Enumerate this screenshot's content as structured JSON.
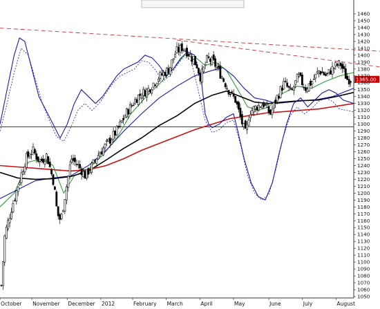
{
  "chart_data": {
    "type": "candlestick",
    "x_labels": [
      "October",
      "November",
      "December",
      "2012",
      "February",
      "March",
      "April",
      "May",
      "June",
      "July",
      "August"
    ],
    "y_ticks": [
      1050,
      1060,
      1070,
      1080,
      1090,
      1100,
      1110,
      1120,
      1130,
      1140,
      1150,
      1160,
      1170,
      1180,
      1190,
      1200,
      1210,
      1220,
      1230,
      1240,
      1250,
      1260,
      1270,
      1280,
      1290,
      1300,
      1310,
      1320,
      1330,
      1340,
      1350,
      1360,
      1370,
      1380,
      1390,
      1400,
      1410,
      1420,
      1430,
      1440,
      1450,
      1460
    ],
    "ylim": [
      1048,
      1468
    ],
    "last_price": {
      "label": "1365.00",
      "value": 1365
    },
    "horizontal_line": 1296,
    "trend_lines": [
      {
        "from": {
          "t": -0.02,
          "v": 1440
        },
        "to": {
          "t": 1.0,
          "v": 1408
        }
      },
      {
        "from": {
          "t": 0.5,
          "v": 1422
        },
        "to": {
          "t": 1.0,
          "v": 1388
        }
      }
    ],
    "close_anchors": [
      [
        0.0,
        1066
      ],
      [
        0.01,
        1140
      ],
      [
        0.03,
        1180
      ],
      [
        0.05,
        1215
      ],
      [
        0.07,
        1250
      ],
      [
        0.09,
        1262
      ],
      [
        0.11,
        1245
      ],
      [
        0.13,
        1255
      ],
      [
        0.15,
        1215
      ],
      [
        0.16,
        1170
      ],
      [
        0.17,
        1160
      ],
      [
        0.18,
        1190
      ],
      [
        0.2,
        1250
      ],
      [
        0.22,
        1240
      ],
      [
        0.24,
        1225
      ],
      [
        0.26,
        1240
      ],
      [
        0.28,
        1258
      ],
      [
        0.3,
        1270
      ],
      [
        0.33,
        1290
      ],
      [
        0.36,
        1318
      ],
      [
        0.39,
        1340
      ],
      [
        0.42,
        1350
      ],
      [
        0.45,
        1368
      ],
      [
        0.48,
        1380
      ],
      [
        0.5,
        1405
      ],
      [
        0.52,
        1412
      ],
      [
        0.54,
        1400
      ],
      [
        0.56,
        1385
      ],
      [
        0.57,
        1368
      ],
      [
        0.59,
        1395
      ],
      [
        0.61,
        1388
      ],
      [
        0.63,
        1370
      ],
      [
        0.65,
        1350
      ],
      [
        0.67,
        1335
      ],
      [
        0.69,
        1300
      ],
      [
        0.7,
        1285
      ],
      [
        0.71,
        1318
      ],
      [
        0.73,
        1325
      ],
      [
        0.75,
        1330
      ],
      [
        0.77,
        1315
      ],
      [
        0.79,
        1340
      ],
      [
        0.81,
        1360
      ],
      [
        0.83,
        1345
      ],
      [
        0.85,
        1370
      ],
      [
        0.87,
        1352
      ],
      [
        0.89,
        1362
      ],
      [
        0.91,
        1378
      ],
      [
        0.93,
        1370
      ],
      [
        0.95,
        1382
      ],
      [
        0.97,
        1388
      ],
      [
        0.99,
        1365
      ],
      [
        1.0,
        1365
      ]
    ],
    "series": [
      {
        "color": "#2ea02e",
        "values": [
          [
            0.0,
            1180
          ],
          [
            0.04,
            1200
          ],
          [
            0.08,
            1245
          ],
          [
            0.12,
            1250
          ],
          [
            0.15,
            1240
          ],
          [
            0.18,
            1200
          ],
          [
            0.21,
            1225
          ],
          [
            0.25,
            1235
          ],
          [
            0.29,
            1255
          ],
          [
            0.33,
            1280
          ],
          [
            0.37,
            1315
          ],
          [
            0.41,
            1338
          ],
          [
            0.45,
            1358
          ],
          [
            0.49,
            1380
          ],
          [
            0.52,
            1400
          ],
          [
            0.55,
            1398
          ],
          [
            0.58,
            1385
          ],
          [
            0.61,
            1390
          ],
          [
            0.64,
            1378
          ],
          [
            0.67,
            1352
          ],
          [
            0.7,
            1325
          ],
          [
            0.73,
            1320
          ],
          [
            0.76,
            1325
          ],
          [
            0.8,
            1345
          ],
          [
            0.84,
            1355
          ],
          [
            0.88,
            1352
          ],
          [
            0.92,
            1362
          ],
          [
            0.96,
            1370
          ],
          [
            1.0,
            1375
          ]
        ]
      },
      {
        "color": "#1a1aaa",
        "values": [
          [
            0.0,
            1192
          ],
          [
            0.05,
            1205
          ],
          [
            0.1,
            1218
          ],
          [
            0.15,
            1222
          ],
          [
            0.2,
            1225
          ],
          [
            0.25,
            1240
          ],
          [
            0.3,
            1262
          ],
          [
            0.35,
            1290
          ],
          [
            0.4,
            1315
          ],
          [
            0.45,
            1338
          ],
          [
            0.5,
            1355
          ],
          [
            0.55,
            1370
          ],
          [
            0.6,
            1378
          ],
          [
            0.63,
            1382
          ],
          [
            0.66,
            1370
          ],
          [
            0.69,
            1352
          ],
          [
            0.72,
            1338
          ],
          [
            0.75,
            1335
          ],
          [
            0.78,
            1330
          ],
          [
            0.82,
            1332
          ],
          [
            0.86,
            1334
          ],
          [
            0.9,
            1336
          ],
          [
            0.94,
            1340
          ],
          [
            1.0,
            1352
          ]
        ]
      },
      {
        "color": "#000000",
        "values": [
          [
            0.0,
            1230
          ],
          [
            0.05,
            1222
          ],
          [
            0.1,
            1220
          ],
          [
            0.15,
            1221
          ],
          [
            0.2,
            1224
          ],
          [
            0.25,
            1232
          ],
          [
            0.3,
            1248
          ],
          [
            0.35,
            1265
          ],
          [
            0.4,
            1280
          ],
          [
            0.45,
            1298
          ],
          [
            0.5,
            1312
          ],
          [
            0.55,
            1330
          ],
          [
            0.6,
            1342
          ],
          [
            0.64,
            1348
          ],
          [
            0.68,
            1340
          ],
          [
            0.72,
            1332
          ],
          [
            0.76,
            1330
          ],
          [
            0.8,
            1332
          ],
          [
            0.85,
            1334
          ],
          [
            0.9,
            1335
          ],
          [
            0.95,
            1340
          ],
          [
            1.0,
            1346
          ]
        ]
      },
      {
        "color": "#cc1111",
        "values": [
          [
            0.0,
            1240
          ],
          [
            0.05,
            1238
          ],
          [
            0.1,
            1236
          ],
          [
            0.15,
            1234
          ],
          [
            0.2,
            1232
          ],
          [
            0.25,
            1234
          ],
          [
            0.3,
            1240
          ],
          [
            0.35,
            1250
          ],
          [
            0.4,
            1262
          ],
          [
            0.45,
            1272
          ],
          [
            0.5,
            1282
          ],
          [
            0.55,
            1292
          ],
          [
            0.6,
            1300
          ],
          [
            0.65,
            1308
          ],
          [
            0.7,
            1312
          ],
          [
            0.75,
            1316
          ],
          [
            0.8,
            1318
          ],
          [
            0.85,
            1320
          ],
          [
            0.9,
            1322
          ],
          [
            0.95,
            1326
          ],
          [
            1.0,
            1330
          ]
        ]
      },
      {
        "color": "#1a1aaa",
        "values": [
          [
            0.0,
            1300
          ],
          [
            0.02,
            1350
          ],
          [
            0.04,
            1400
          ],
          [
            0.055,
            1425
          ],
          [
            0.07,
            1420
          ],
          [
            0.09,
            1380
          ],
          [
            0.11,
            1340
          ],
          [
            0.13,
            1320
          ],
          [
            0.15,
            1300
          ],
          [
            0.17,
            1280
          ],
          [
            0.19,
            1300
          ],
          [
            0.21,
            1330
          ],
          [
            0.23,
            1350
          ],
          [
            0.25,
            1340
          ],
          [
            0.27,
            1330
          ],
          [
            0.29,
            1340
          ],
          [
            0.31,
            1355
          ],
          [
            0.33,
            1370
          ],
          [
            0.35,
            1380
          ],
          [
            0.37,
            1385
          ],
          [
            0.39,
            1390
          ],
          [
            0.41,
            1400
          ],
          [
            0.43,
            1396
          ],
          [
            0.45,
            1385
          ],
          [
            0.47,
            1370
          ],
          [
            0.49,
            1380
          ],
          [
            0.51,
            1395
          ],
          [
            0.53,
            1405
          ],
          [
            0.55,
            1400
          ],
          [
            0.57,
            1360
          ],
          [
            0.58,
            1315
          ],
          [
            0.59,
            1300
          ],
          [
            0.6,
            1295
          ],
          [
            0.62,
            1300
          ],
          [
            0.64,
            1310
          ],
          [
            0.66,
            1315
          ],
          [
            0.67,
            1295
          ],
          [
            0.69,
            1250
          ],
          [
            0.71,
            1215
          ],
          [
            0.73,
            1195
          ],
          [
            0.75,
            1190
          ],
          [
            0.77,
            1215
          ],
          [
            0.79,
            1260
          ],
          [
            0.81,
            1300
          ],
          [
            0.83,
            1330
          ],
          [
            0.85,
            1338
          ],
          [
            0.87,
            1325
          ],
          [
            0.89,
            1335
          ],
          [
            0.91,
            1345
          ],
          [
            0.93,
            1350
          ],
          [
            0.95,
            1345
          ],
          [
            0.97,
            1335
          ],
          [
            1.0,
            1330
          ]
        ]
      },
      {
        "color": "#1a1aaa",
        "dashed": true,
        "values": [
          [
            0.0,
            1290
          ],
          [
            0.02,
            1330
          ],
          [
            0.04,
            1375
          ],
          [
            0.06,
            1410
          ],
          [
            0.08,
            1400
          ],
          [
            0.1,
            1365
          ],
          [
            0.12,
            1330
          ],
          [
            0.14,
            1305
          ],
          [
            0.16,
            1282
          ],
          [
            0.18,
            1275
          ],
          [
            0.2,
            1295
          ],
          [
            0.22,
            1320
          ],
          [
            0.24,
            1330
          ],
          [
            0.26,
            1320
          ],
          [
            0.28,
            1330
          ],
          [
            0.3,
            1345
          ],
          [
            0.32,
            1360
          ],
          [
            0.34,
            1370
          ],
          [
            0.36,
            1375
          ],
          [
            0.38,
            1380
          ],
          [
            0.4,
            1392
          ],
          [
            0.42,
            1390
          ],
          [
            0.44,
            1378
          ],
          [
            0.46,
            1362
          ],
          [
            0.48,
            1370
          ],
          [
            0.5,
            1385
          ],
          [
            0.52,
            1398
          ],
          [
            0.54,
            1392
          ],
          [
            0.56,
            1350
          ],
          [
            0.58,
            1305
          ],
          [
            0.6,
            1288
          ],
          [
            0.62,
            1292
          ],
          [
            0.64,
            1302
          ],
          [
            0.66,
            1306
          ],
          [
            0.68,
            1270
          ],
          [
            0.7,
            1225
          ],
          [
            0.72,
            1200
          ],
          [
            0.74,
            1190
          ],
          [
            0.76,
            1198
          ],
          [
            0.78,
            1235
          ],
          [
            0.8,
            1280
          ],
          [
            0.82,
            1312
          ],
          [
            0.84,
            1325
          ],
          [
            0.86,
            1315
          ],
          [
            0.88,
            1322
          ],
          [
            0.9,
            1333
          ],
          [
            0.92,
            1338
          ],
          [
            0.94,
            1333
          ],
          [
            0.96,
            1322
          ],
          [
            1.0,
            1318
          ]
        ]
      }
    ]
  }
}
